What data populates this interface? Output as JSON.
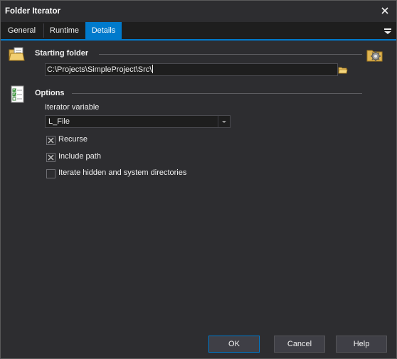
{
  "window": {
    "title": "Folder Iterator"
  },
  "tabs": [
    {
      "label": "General"
    },
    {
      "label": "Runtime"
    },
    {
      "label": "Details",
      "active": true
    }
  ],
  "starting_folder": {
    "title": "Starting folder",
    "value": "C:\\Projects\\SimpleProject\\Src\\"
  },
  "options": {
    "title": "Options",
    "iterator_label": "Iterator variable",
    "iterator_value": "L_File",
    "checkboxes": [
      {
        "label": "Recurse",
        "checked": true
      },
      {
        "label": "Include path",
        "checked": true
      },
      {
        "label": "Iterate hidden and system directories",
        "checked": false
      }
    ]
  },
  "buttons": {
    "ok": "OK",
    "cancel": "Cancel",
    "help": "Help"
  },
  "colors": {
    "accent": "#007acc",
    "background": "#2d2d30",
    "field": "#1e1e1e"
  }
}
